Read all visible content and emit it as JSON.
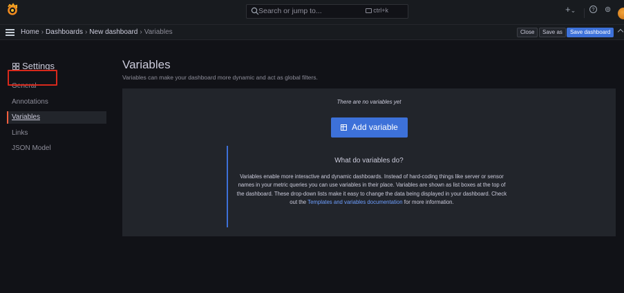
{
  "topbar": {
    "search_placeholder": "Search or jump to...",
    "shortcut": "ctrl+k",
    "plus": "+",
    "plus_chevron": "⌄",
    "help": "?",
    "news": "⊚"
  },
  "breadcrumbs": {
    "home": "Home",
    "dashboards": "Dashboards",
    "new_dashboard": "New dashboard",
    "current": "Variables",
    "separator": "›"
  },
  "actions": {
    "close": "Close",
    "save_as": "Save as",
    "save_dashboard": "Save dashboard"
  },
  "sidebar": {
    "title": "Settings",
    "items": [
      {
        "label": "General"
      },
      {
        "label": "Annotations"
      },
      {
        "label": "Variables"
      },
      {
        "label": "Links"
      },
      {
        "label": "JSON Model"
      }
    ]
  },
  "main": {
    "title": "Variables",
    "description": "Variables can make your dashboard more dynamic and act as global filters.",
    "empty_text": "There are no variables yet",
    "add_button": "Add variable",
    "help_title": "What do variables do?",
    "help_body_1": "Variables enable more interactive and dynamic dashboards. Instead of hard-coding things like server or sensor names in your metric queries you can use variables in their place. Variables are shown as list boxes at the top of the dashboard. These drop-down lists make it easy to change the data being displayed in your dashboard. Check out the ",
    "help_link": "Templates and variables documentation",
    "help_body_2": " for more information."
  },
  "colors": {
    "accent": "#3d71d9",
    "background": "#111217",
    "panel": "#22252b",
    "highlight_box": "#d9291c"
  }
}
